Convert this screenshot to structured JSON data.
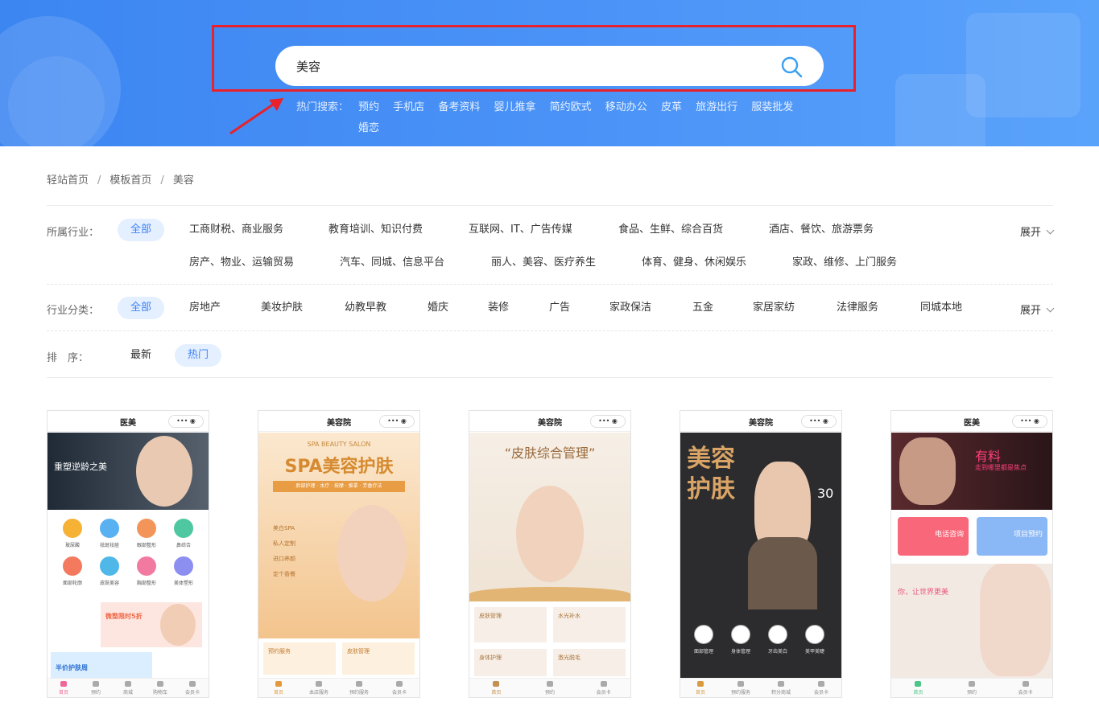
{
  "search": {
    "value": "美容"
  },
  "hot_search": {
    "label": "热门搜索：",
    "items": [
      "预约",
      "手机店",
      "备考资料",
      "婴儿推拿",
      "简约欧式",
      "移动办公",
      "皮革",
      "旅游出行",
      "服装批发",
      "婚恋"
    ]
  },
  "breadcrumb": [
    "轻站首页",
    "模板首页",
    "美容"
  ],
  "industry": {
    "label": "所属行业：",
    "all": "全部",
    "row1": [
      "工商财税、商业服务",
      "教育培训、知识付费",
      "互联网、IT、广告传媒",
      "食品、生鲜、综合百货",
      "酒店、餐饮、旅游票务"
    ],
    "row2": [
      "房产、物业、运输贸易",
      "汽车、同城、信息平台",
      "丽人、美容、医疗养生",
      "体育、健身、休闲娱乐",
      "家政、维修、上门服务"
    ],
    "expand": "展开"
  },
  "category": {
    "label": "行业分类：",
    "all": "全部",
    "items": [
      "房地产",
      "美妆护肤",
      "幼教早教",
      "婚庆",
      "装修",
      "广告",
      "家政保洁",
      "五金",
      "家居家纺",
      "法律服务",
      "同城本地"
    ],
    "expand": "展开"
  },
  "sort": {
    "label": "排　序：",
    "items": [
      "最新",
      "热门"
    ]
  },
  "cards": [
    {
      "title": "医美",
      "banner_text": "重塑逆龄之美",
      "icons": [
        "玻尿酸",
        "祛斑祛痘",
        "眼部整形",
        "鼻综合",
        "面部轮廓",
        "皮肤美容",
        "胸部整形",
        "美体塑形"
      ],
      "promo": "微整限时5折",
      "promo2": "半价护肤周",
      "tabs": [
        "首页",
        "预约",
        "商城",
        "购物车",
        "会员卡"
      ]
    },
    {
      "title": "美容院",
      "banner_sub": "SPA BEAUTY SALON",
      "banner_text": "SPA美容护肤",
      "banner_tag": "脸部护理 · 水疗 · 按摩 · 推拿 · 芳香疗法",
      "checks": [
        "美白SPA",
        "私人定制",
        "进口养颜",
        "定个香餐"
      ],
      "services": [
        "预约服务",
        "皮肤管理"
      ],
      "tabs": [
        "首页",
        "本店服务",
        "预约服务",
        "会员卡"
      ]
    },
    {
      "title": "美容院",
      "banner_text": "“皮肤综合管理”",
      "services": [
        "皮肤管理",
        "水光补水",
        "身体护理",
        "激光脱毛"
      ],
      "tabs": [
        "首页",
        "预约",
        "会员卡"
      ]
    },
    {
      "title": "美容院",
      "banner_text1": "美容",
      "banner_text2": "护肤",
      "banner_num": "30",
      "icons": [
        "面部管理",
        "身体管理",
        "牙齿美白",
        "美甲美睫"
      ],
      "tabs": [
        "首页",
        "预约服务",
        "积分商城",
        "会员卡"
      ]
    },
    {
      "title": "医美",
      "banner_text": "有料",
      "banner_sub": "走到哪里都是焦点",
      "btn1": "电话咨询",
      "btn2": "项目预约",
      "headline": "你，让世界更美",
      "tabs": [
        "首页",
        "预约",
        "会员卡"
      ]
    }
  ],
  "colors": {
    "hero": "#3c86f2",
    "accent": "#3f83f5",
    "frame": "#e8212b"
  }
}
